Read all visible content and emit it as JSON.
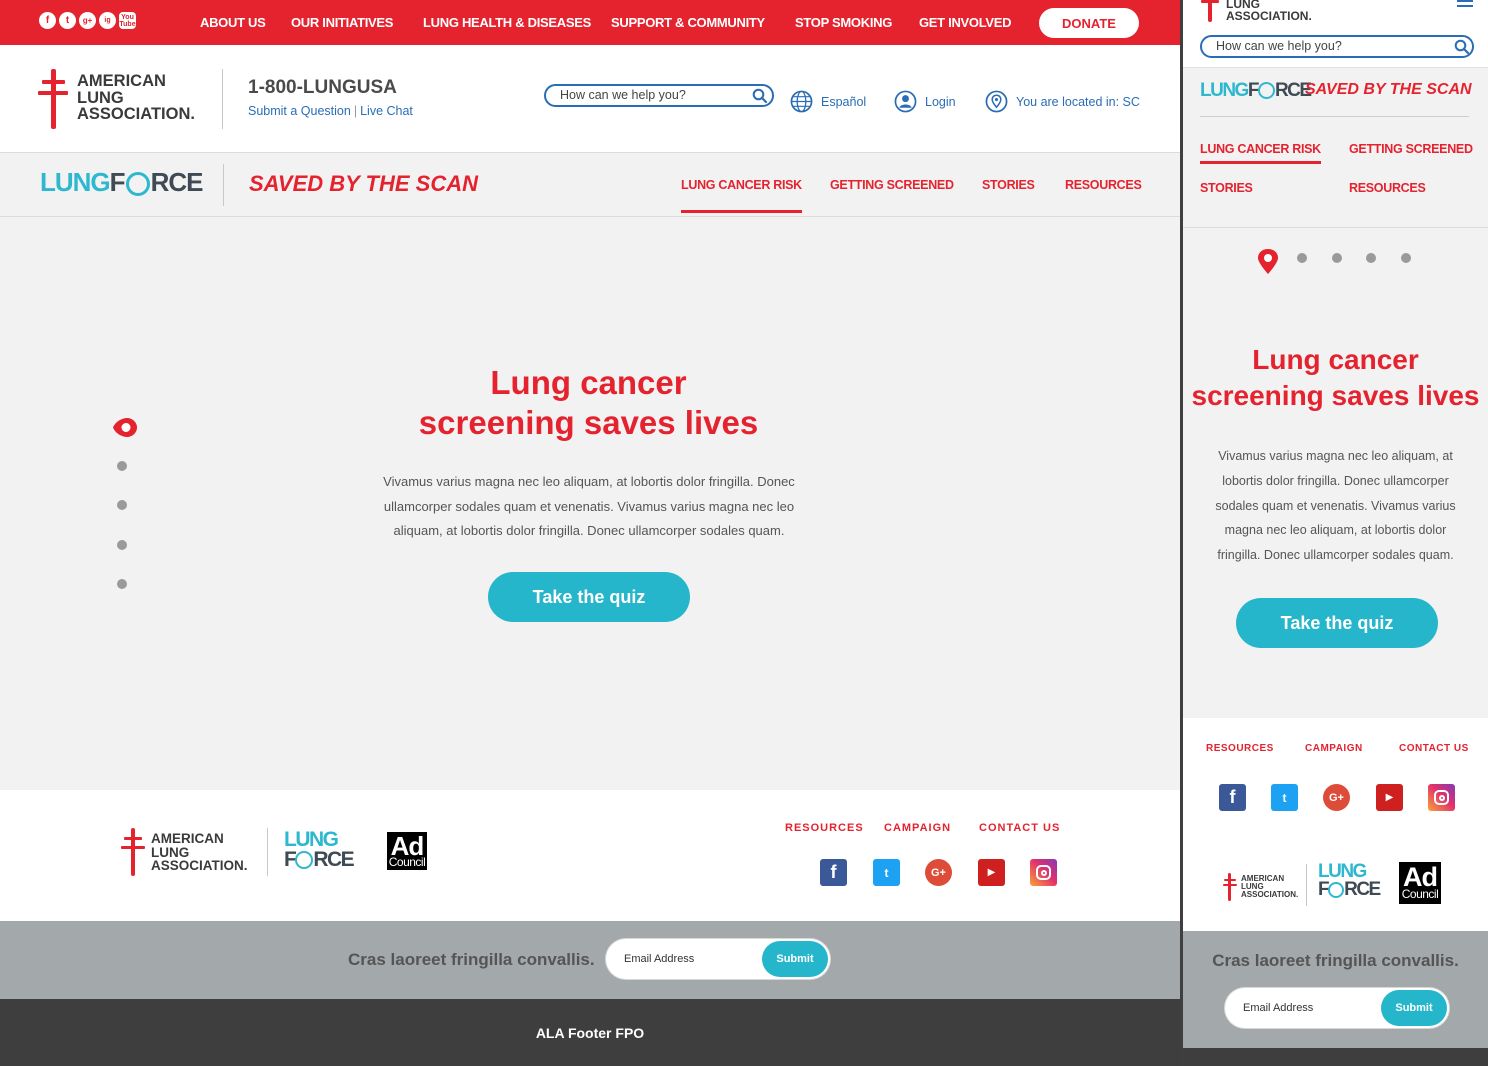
{
  "top_bar": {
    "social": [
      "f",
      "t",
      "g+",
      "ig",
      "You Tube"
    ],
    "nav": [
      "ABOUT US",
      "OUR INITIATIVES",
      "LUNG HEALTH & DISEASES",
      "SUPPORT & COMMUNITY",
      "STOP SMOKING",
      "GET INVOLVED"
    ],
    "donate": "DONATE"
  },
  "header": {
    "logo_lines": [
      "AMERICAN",
      "LUNG",
      "ASSOCIATION."
    ],
    "phone": "1-800-LUNGUSA",
    "submit_question": "Submit a Question",
    "live_chat": "Live Chat",
    "search_placeholder": "How can we help you?",
    "espanol": "Español",
    "login": "Login",
    "location": "You are located in: SC"
  },
  "subnav": {
    "lung": "LUNG",
    "force_f": "F",
    "force_rest": "RCE",
    "campaign": "SAVED BY THE SCAN",
    "items": [
      "LUNG CANCER RISK",
      "GETTING SCREENED",
      "STORIES",
      "RESOURCES"
    ]
  },
  "hero": {
    "title_line1": "Lung cancer",
    "title_line2": "screening saves lives",
    "body": "Vivamus varius magna nec leo aliquam, at lobortis dolor fringilla. Donec ullamcorper sodales quam et venenatis. Vivamus varius magna nec leo aliquam, at lobortis dolor fringilla. Donec ullamcorper sodales quam.",
    "cta": "Take the quiz",
    "slides_total": 5,
    "active_slide": 1
  },
  "footer": {
    "links": [
      "RESOURCES",
      "CAMPAIGN",
      "CONTACT US"
    ],
    "social_icons": [
      "facebook-icon",
      "twitter-icon",
      "google-plus-icon",
      "youtube-icon",
      "instagram-icon"
    ],
    "adcouncil_top": "Ad",
    "adcouncil_bottom": "Council"
  },
  "newsletter": {
    "text": "Cras laoreet fringilla convallis.",
    "email_placeholder": "Email Address",
    "submit": "Submit"
  },
  "footer_bottom": {
    "text": "ALA Footer FPO"
  },
  "mobile": {
    "logo_lines": [
      "LUNG",
      "ASSOCIATION."
    ],
    "search_placeholder": "How can we help you?",
    "title_line1": "Lung cancer",
    "title_line2": "screening saves lives",
    "body": "Vivamus varius magna nec leo aliquam, at lobortis dolor fringilla. Donec ullamcorper sodales quam et venenatis. Vivamus varius magna nec leo aliquam, at lobortis dolor fringilla. Donec ullamcorper sodales quam."
  },
  "colors": {
    "brand_red": "#e4232f",
    "brand_teal": "#26b6cb",
    "link_blue": "#2a6db5",
    "panel_gray": "#f2f2f3"
  }
}
